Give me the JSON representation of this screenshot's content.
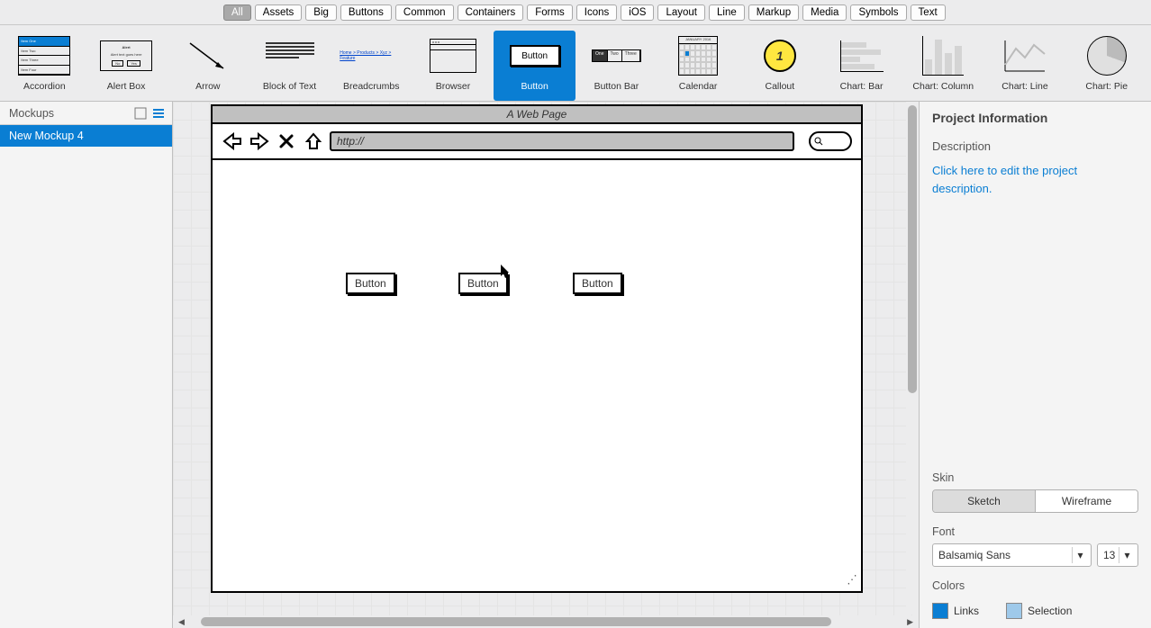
{
  "filters": [
    "All",
    "Assets",
    "Big",
    "Buttons",
    "Common",
    "Containers",
    "Forms",
    "Icons",
    "iOS",
    "Layout",
    "Line",
    "Markup",
    "Media",
    "Symbols",
    "Text"
  ],
  "filters_active": "All",
  "library": {
    "items": [
      {
        "label": "Accordion"
      },
      {
        "label": "Alert Box"
      },
      {
        "label": "Arrow"
      },
      {
        "label": "Block of Text"
      },
      {
        "label": "Breadcrumbs"
      },
      {
        "label": "Browser"
      },
      {
        "label": "Button"
      },
      {
        "label": "Button Bar"
      },
      {
        "label": "Calendar"
      },
      {
        "label": "Callout"
      },
      {
        "label": "Chart: Bar"
      },
      {
        "label": "Chart: Column"
      },
      {
        "label": "Chart: Line"
      },
      {
        "label": "Chart: Pie"
      }
    ],
    "selected": "Button",
    "button_thumb_text": "Button",
    "callout_thumb_text": "1",
    "alert_title": "Alert",
    "alert_body": "Alert text goes here",
    "alert_no": "No",
    "alert_yes": "Yes",
    "bbar": [
      "One",
      "Two",
      "Three"
    ],
    "bread": "Home > Products > Xyz > Feature",
    "cal_head": "JANUARY 2016"
  },
  "sidebar": {
    "title": "Mockups",
    "items": [
      "New Mockup 4"
    ]
  },
  "canvas": {
    "browser_title": "A Web Page",
    "url": "http://",
    "buttons": [
      "Button",
      "Button",
      "Button"
    ]
  },
  "inspector": {
    "title": "Project Information",
    "desc_label": "Description",
    "desc_placeholder": "Click here to edit the project description.",
    "skin_label": "Skin",
    "skin_options": [
      "Sketch",
      "Wireframe"
    ],
    "skin_active": "Sketch",
    "font_label": "Font",
    "font_name": "Balsamiq Sans",
    "font_size": "13",
    "colors_label": "Colors",
    "links_label": "Links",
    "links_color": "#0a7ed3",
    "selection_label": "Selection",
    "selection_color": "#9ec9ea"
  }
}
